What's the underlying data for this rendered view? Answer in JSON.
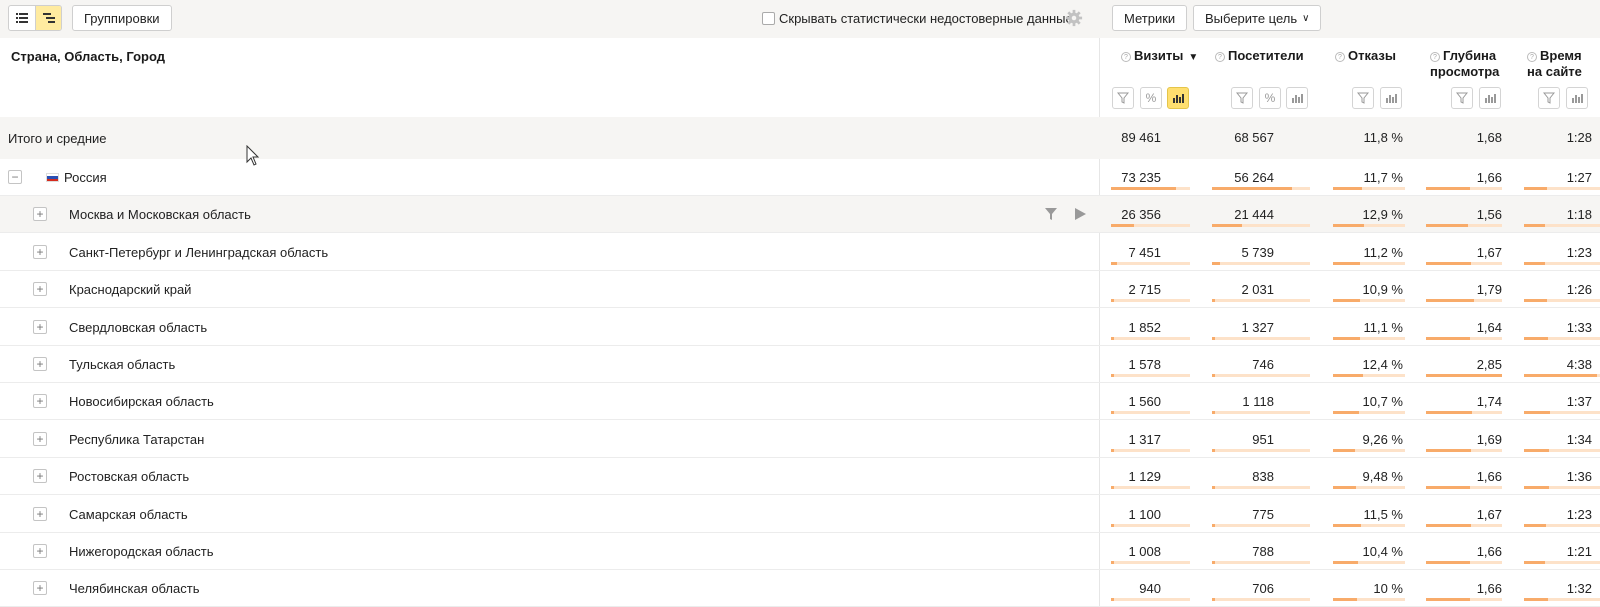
{
  "toolbar": {
    "view_list_icon": "list-icon",
    "view_tree_icon": "tree-icon",
    "groupings_label": "Группировки",
    "hide_unreliable_label": "Скрывать статистически недостоверные данные",
    "hide_unreliable_checked": false,
    "metrics_label": "Метрики",
    "goal_label": "Выберите цель"
  },
  "header": {
    "dimension_title": "Страна, Область, Город",
    "metrics": [
      {
        "label": "Визиты",
        "sorted": true,
        "sort_icon": "▼"
      },
      {
        "label": "Посетители"
      },
      {
        "label": "Отказы"
      },
      {
        "label_line1": "Глубина",
        "label_line2": "просмотра"
      },
      {
        "label_line1": "Время",
        "label_line2": "на сайте"
      }
    ]
  },
  "totals": {
    "label": "Итого и средние",
    "values": [
      "89 461",
      "68 567",
      "11,8 %",
      "1,68",
      "1:28"
    ]
  },
  "rows": [
    {
      "name": "Россия",
      "expand": "−",
      "values": [
        "73 235",
        "56 264",
        "11,7 %",
        "1,66",
        "1:27"
      ],
      "bars": [
        0.82,
        0.82,
        0.4,
        0.58,
        0.3
      ]
    },
    {
      "name": "Москва и Московская область",
      "expand": "+",
      "values": [
        "26 356",
        "21 444",
        "12,9 %",
        "1,56",
        "1:18"
      ],
      "bars": [
        0.29,
        0.31,
        0.43,
        0.55,
        0.27
      ]
    },
    {
      "name": "Санкт-Петербург и Ленинградская область",
      "expand": "+",
      "values": [
        "7 451",
        "5 739",
        "11,2 %",
        "1,67",
        "1:23"
      ],
      "bars": [
        0.08,
        0.08,
        0.38,
        0.59,
        0.28
      ]
    },
    {
      "name": "Краснодарский край",
      "expand": "+",
      "values": [
        "2 715",
        "2 031",
        "10,9 %",
        "1,79",
        "1:26"
      ],
      "bars": [
        0.03,
        0.03,
        0.37,
        0.63,
        0.3
      ]
    },
    {
      "name": "Свердловская область",
      "expand": "+",
      "values": [
        "1 852",
        "1 327",
        "11,1 %",
        "1,64",
        "1:33"
      ],
      "bars": [
        0.02,
        0.02,
        0.38,
        0.58,
        0.32
      ]
    },
    {
      "name": "Тульская область",
      "expand": "+",
      "values": [
        "1 578",
        "746",
        "12,4 %",
        "2,85",
        "4:38"
      ],
      "bars": [
        0.02,
        0.01,
        0.42,
        1.0,
        0.96
      ]
    },
    {
      "name": "Новосибирская область",
      "expand": "+",
      "values": [
        "1 560",
        "1 118",
        "10,7 %",
        "1,74",
        "1:37"
      ],
      "bars": [
        0.02,
        0.02,
        0.36,
        0.61,
        0.34
      ]
    },
    {
      "name": "Республика Татарстан",
      "expand": "+",
      "values": [
        "1 317",
        "951",
        "9,26 %",
        "1,69",
        "1:34"
      ],
      "bars": [
        0.01,
        0.01,
        0.31,
        0.59,
        0.33
      ]
    },
    {
      "name": "Ростовская область",
      "expand": "+",
      "values": [
        "1 129",
        "838",
        "9,48 %",
        "1,66",
        "1:36"
      ],
      "bars": [
        0.01,
        0.01,
        0.32,
        0.58,
        0.33
      ]
    },
    {
      "name": "Самарская область",
      "expand": "+",
      "values": [
        "1 100",
        "775",
        "11,5 %",
        "1,67",
        "1:23"
      ],
      "bars": [
        0.01,
        0.01,
        0.39,
        0.59,
        0.29
      ]
    },
    {
      "name": "Нижегородская область",
      "expand": "+",
      "values": [
        "1 008",
        "788",
        "10,4 %",
        "1,66",
        "1:21"
      ],
      "bars": [
        0.01,
        0.01,
        0.35,
        0.58,
        0.28
      ]
    },
    {
      "name": "Челябинская область",
      "expand": "+",
      "values": [
        "940",
        "706",
        "10 %",
        "1,66",
        "1:32"
      ],
      "bars": [
        0.01,
        0.01,
        0.34,
        0.58,
        0.32
      ]
    }
  ],
  "colors": {
    "accent": "#ffdf6f",
    "bar": "#f8ab6a",
    "bar_track": "#fde2c9",
    "panel_bg": "#f6f5f3"
  }
}
